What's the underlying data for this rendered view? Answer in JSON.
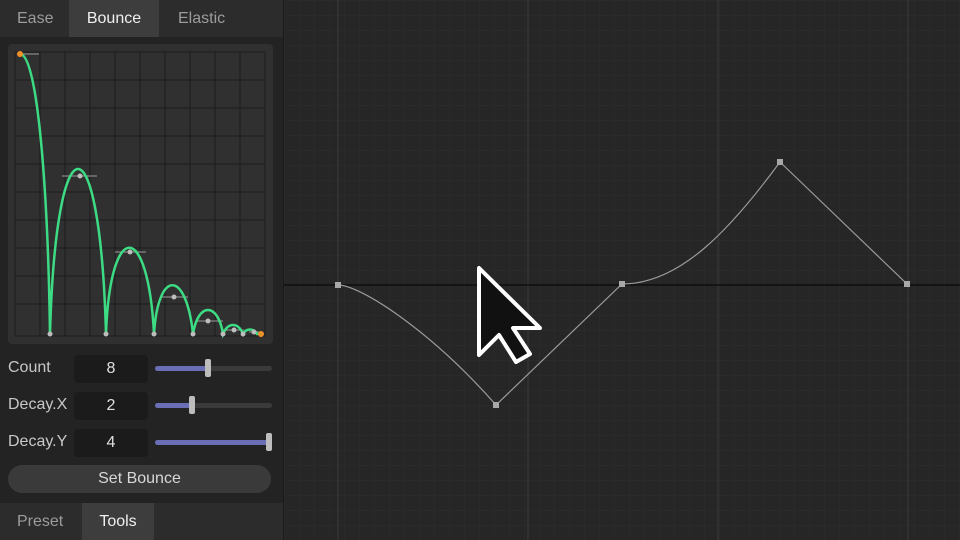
{
  "tabs_top": [
    {
      "label": "Ease",
      "active": false
    },
    {
      "label": "Bounce",
      "active": true
    },
    {
      "label": "Elastic",
      "active": false
    }
  ],
  "params": {
    "count": {
      "label": "Count",
      "value": "8",
      "fraction": 0.45
    },
    "decay_x": {
      "label": "Decay.X",
      "value": "2",
      "fraction": 0.32
    },
    "decay_y": {
      "label": "Decay.Y",
      "value": "4",
      "fraction": 1.0
    }
  },
  "set_button_label": "Set Bounce",
  "tabs_bottom": [
    {
      "label": "Preset",
      "active": false
    },
    {
      "label": "Tools",
      "active": true
    }
  ],
  "colors": {
    "curve": "#3ddc84",
    "endpoint": "#f0902a",
    "slider_fill": "#6a6fb5"
  },
  "cursor_icon": "arrow-cursor-icon"
}
